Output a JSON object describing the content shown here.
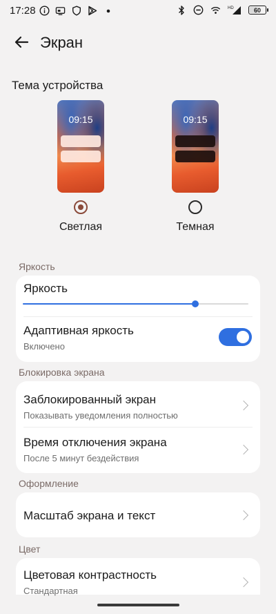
{
  "status_bar": {
    "time": "17:28",
    "left_icons": [
      "info-icon",
      "cast-icon",
      "shield-icon",
      "play-store-icon",
      "dot-icon"
    ],
    "right_icons": [
      "bluetooth-icon",
      "do-not-disturb-icon",
      "wifi-icon",
      "signal-icon"
    ],
    "signal_label": "HD",
    "battery_text": "60",
    "battery_level": 0.6
  },
  "header": {
    "title": "Экран"
  },
  "theme": {
    "title": "Тема устройства",
    "options": [
      {
        "label": "Светлая",
        "preview_time": "09:15",
        "selected": true
      },
      {
        "label": "Темная",
        "preview_time": "09:15",
        "selected": false
      }
    ]
  },
  "brightness": {
    "section_title": "Яркость",
    "slider_label": "Яркость",
    "slider_value": 0.765,
    "adaptive_title": "Адаптивная яркость",
    "adaptive_status": "Включено",
    "adaptive_enabled": true
  },
  "lock_screen": {
    "section_title": "Блокировка экрана",
    "items": [
      {
        "title": "Заблокированный экран",
        "subtitle": "Показывать уведомления полностью"
      },
      {
        "title": "Время отключения экрана",
        "subtitle": "После 5 минут бездействия"
      }
    ]
  },
  "appearance": {
    "section_title": "Оформление",
    "items": [
      {
        "title": "Масштаб экрана и текст"
      }
    ]
  },
  "color": {
    "section_title": "Цвет",
    "items": [
      {
        "title": "Цветовая контрастность",
        "subtitle": "Стандартная"
      }
    ]
  },
  "colors": {
    "accent": "#2f6fe0",
    "radio_selected": "#8a4a3a",
    "background": "#f3f2f2",
    "card": "#ffffff"
  }
}
